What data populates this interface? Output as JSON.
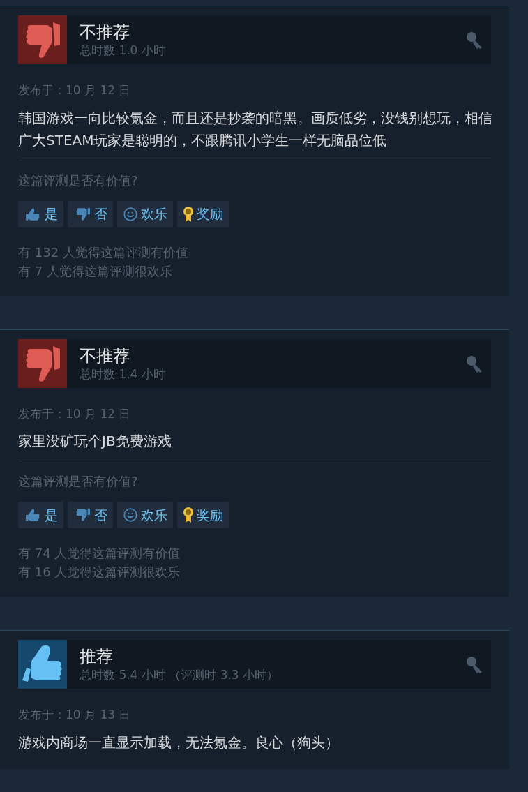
{
  "reviews": [
    {
      "kind": "not_recommended",
      "title": "不推荐",
      "hours": "总时数 1.0 小时",
      "posted": "发布于：10 月 12 日",
      "text": "韩国游戏一向比较氪金，而且还是抄袭的暗黑。画质低劣，没钱别想玩，相信广大STEAM玩家是聪明的，不跟腾讯小学生一样无脑品位低",
      "question": "这篇评测是否有价值?",
      "buttons": [
        "是",
        "否",
        "欢乐",
        "奖励"
      ],
      "counts": [
        "有 132 人觉得这篇评测有价值",
        "有 7 人觉得这篇评测很欢乐"
      ]
    },
    {
      "kind": "not_recommended",
      "title": "不推荐",
      "hours": "总时数 1.4 小时",
      "posted": "发布于：10 月 12 日",
      "text": "家里没矿玩个JB免费游戏",
      "question": "这篇评测是否有价值?",
      "buttons": [
        "是",
        "否",
        "欢乐",
        "奖励"
      ],
      "counts": [
        "有 74 人觉得这篇评测有价值",
        "有 16 人觉得这篇评测很欢乐"
      ]
    },
    {
      "kind": "recommended",
      "title": "推荐",
      "hours": "总时数 5.4 小时 （评测时 3.3 小时）",
      "posted": "发布于：10 月 13 日",
      "text": "游戏内商场一直显示加载，无法氪金。良心（狗头）"
    }
  ]
}
